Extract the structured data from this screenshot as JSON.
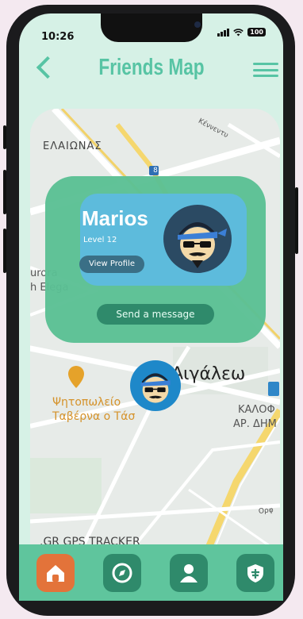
{
  "status": {
    "time": "10:26",
    "battery": "100"
  },
  "header": {
    "title": "Friends Map"
  },
  "map_labels": {
    "elaionas": "ΕΛΑΙΩΝΑΣ",
    "kennedy": "Κέννεντυ",
    "route": "8",
    "aurora": "urora",
    "elegance": "h Elega",
    "aigaleo": "Αιγάλεω",
    "restaurant_line1": "Ψητοπωλείο",
    "restaurant_line2": "Ταβέρνα ο Τάσ",
    "kalof": "ΚΑΛΟΦ",
    "ar_dim": "ΑΡ. ΔΗΜ",
    "orf": "Ορφ",
    "gps_tracker": ".GR GPS TRACKER"
  },
  "friend_card": {
    "name": "Marios",
    "level": "Level 12",
    "view_profile": "View Profile",
    "send_message": "Send a message"
  },
  "tabs": [
    {
      "icon": "home-icon",
      "active": true
    },
    {
      "icon": "compass-icon",
      "active": false
    },
    {
      "icon": "profile-icon",
      "active": false
    },
    {
      "icon": "shield-icon",
      "active": false
    }
  ],
  "colors": {
    "accent": "#57c4a4",
    "card_outer": "#5bbf94",
    "card_inner": "#5dbbdc",
    "tab_active": "#e3733a",
    "tab_bar": "#5fc59d"
  }
}
